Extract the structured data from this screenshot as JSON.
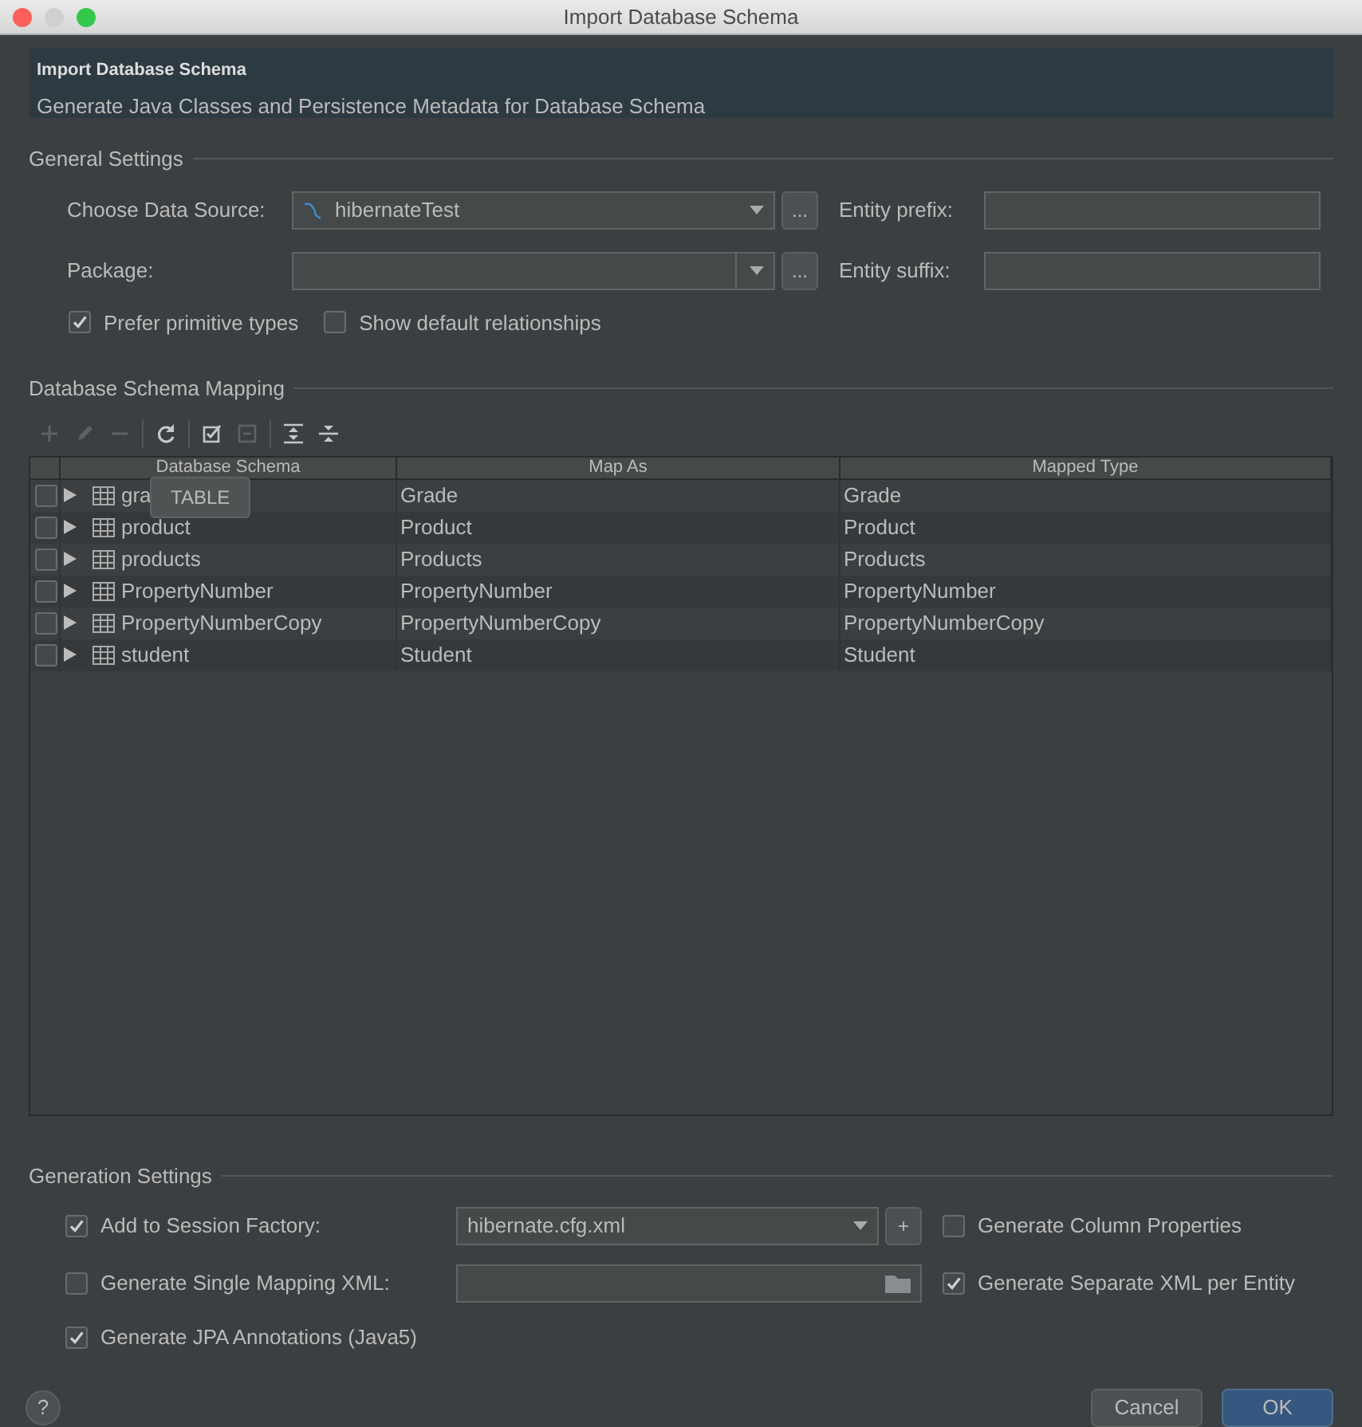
{
  "window": {
    "title": "Import Database Schema"
  },
  "banner": {
    "title": "Import Database Schema",
    "subtitle": "Generate Java Classes and Persistence Metadata for Database Schema"
  },
  "general_settings": {
    "heading": "General Settings",
    "data_source": {
      "label": "Choose Data Source:",
      "value": "hibernateTest",
      "browse": "..."
    },
    "package": {
      "label": "Package:",
      "browse": "..."
    },
    "entity_prefix": {
      "label": "Entity prefix:"
    },
    "entity_suffix": {
      "label": "Entity suffix:"
    },
    "options": [
      {
        "label": "Prefer primitive types",
        "checked": true
      },
      {
        "label": "Show default relationships",
        "checked": false
      }
    ]
  },
  "mapping": {
    "heading": "Database Schema Mapping",
    "toolbar": [
      [
        {
          "kind": "add",
          "disabled": true
        },
        {
          "kind": "edit",
          "disabled": true
        },
        {
          "kind": "remove",
          "disabled": true
        }
      ],
      [
        {
          "kind": "refresh",
          "disabled": false
        }
      ],
      [
        {
          "kind": "check",
          "disabled": false
        },
        {
          "kind": "uncheck",
          "disabled": true
        }
      ],
      [
        {
          "kind": "expand",
          "disabled": false
        },
        {
          "kind": "collapse",
          "disabled": false
        }
      ]
    ],
    "table": {
      "columns": [
        "Database Schema",
        "Map As",
        "Mapped Type"
      ],
      "rows": [
        {
          "checked": false,
          "schema": "gra",
          "map_as": "Grade",
          "mapped_type": "Grade"
        },
        {
          "checked": false,
          "schema": "product",
          "map_as": "Product",
          "mapped_type": "Product"
        },
        {
          "checked": false,
          "schema": "products",
          "map_as": "Products",
          "mapped_type": "Products"
        },
        {
          "checked": false,
          "schema": "PropertyNumber",
          "map_as": "PropertyNumber",
          "mapped_type": "PropertyNumber"
        },
        {
          "checked": false,
          "schema": "PropertyNumberCopy",
          "map_as": "PropertyNumberCopy",
          "mapped_type": "PropertyNumberCopy"
        },
        {
          "checked": false,
          "schema": "student",
          "map_as": "Student",
          "mapped_type": "Student"
        }
      ]
    },
    "tooltip": "TABLE"
  },
  "generation_settings": {
    "heading": "Generation Settings",
    "session_factory": {
      "label": "Add to Session Factory:",
      "checked": true,
      "value": "hibernate.cfg.xml",
      "add": "+"
    },
    "column_properties": {
      "label": "Generate Column Properties",
      "checked": false
    },
    "single_mapping": {
      "label": "Generate Single Mapping XML:",
      "checked": false
    },
    "separate_xml": {
      "label": "Generate Separate XML per Entity",
      "checked": true
    },
    "jpa": {
      "label": "Generate JPA Annotations (Java5)",
      "checked": true
    }
  },
  "footer": {
    "help": "?",
    "buttons": [
      {
        "label": "Cancel",
        "default": false
      },
      {
        "label": "OK",
        "default": true
      }
    ]
  }
}
